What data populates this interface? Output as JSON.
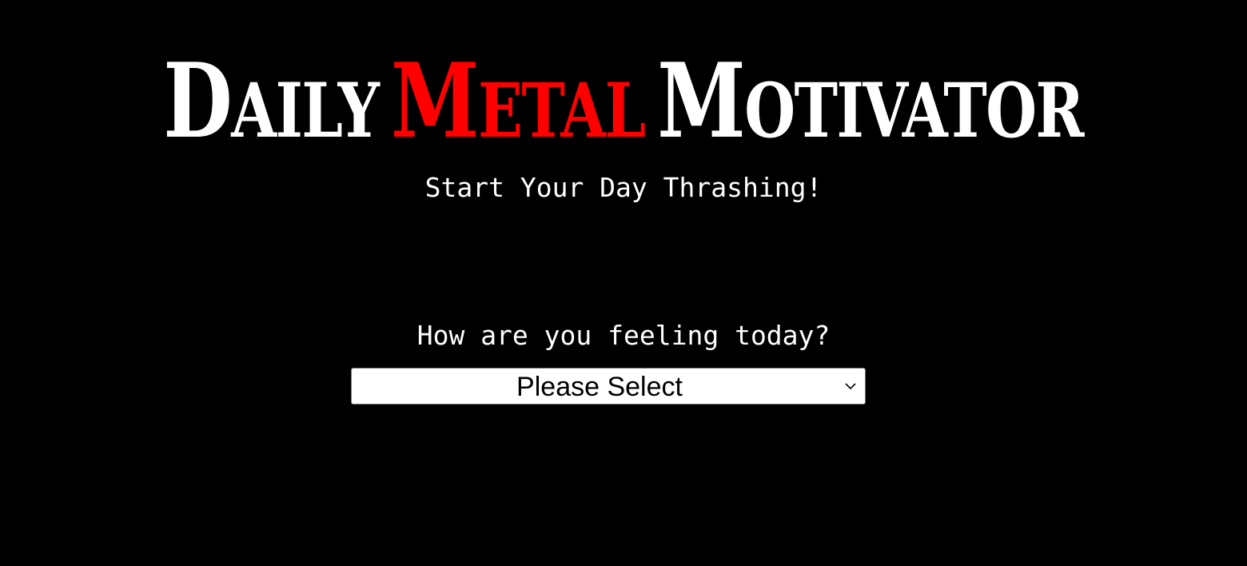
{
  "header": {
    "title_words": [
      {
        "cap": "D",
        "rest": "AILY",
        "color": "#ffffff"
      },
      {
        "cap": "M",
        "rest": "ETAL",
        "color": "#ff0000"
      },
      {
        "cap": "M",
        "rest": "OTIVATOR",
        "color": "#ffffff"
      }
    ],
    "title": "Daily Metal Motivator",
    "tagline": "Start Your Day Thrashing!"
  },
  "mood_form": {
    "question": "How are you feeling today?",
    "select_value": "Please Select",
    "chevron_icon": "chevron-down-icon"
  },
  "colors": {
    "background": "#000000",
    "accent": "#ff0000",
    "text": "#ffffff"
  }
}
